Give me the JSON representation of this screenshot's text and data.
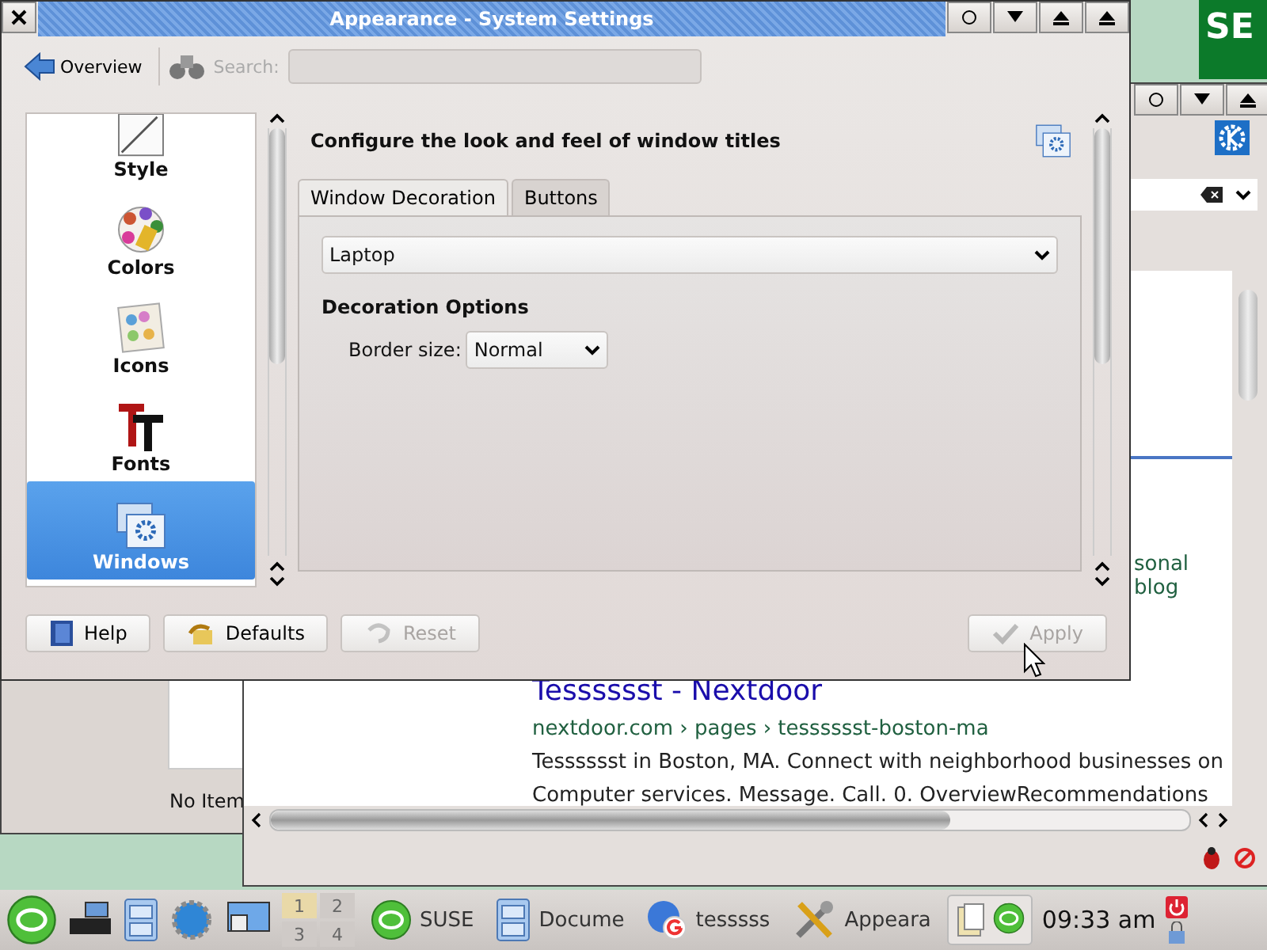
{
  "desktop_logo": {
    "text": "SE"
  },
  "file_window": {
    "status": "No Item"
  },
  "browser": {
    "result_title": "Tesssssst - Nextdoor",
    "result_url": "nextdoor.com › pages › tesssssst-boston-ma",
    "result_snippet": [
      "Tesssssst in Boston, MA. Connect with neighborhood businesses on",
      "Computer services. Message. Call. 0. OverviewRecommendations"
    ],
    "side_text": "sonal blog"
  },
  "window": {
    "title": "Appearance - System Settings"
  },
  "toolbar": {
    "back_label": "Overview",
    "search_label": "Search:"
  },
  "sidebar": {
    "items": [
      {
        "label": "Style",
        "kind": "style",
        "selected": false
      },
      {
        "label": "Colors",
        "kind": "colors",
        "selected": false
      },
      {
        "label": "Icons",
        "kind": "icons",
        "selected": false
      },
      {
        "label": "Fonts",
        "kind": "fonts",
        "selected": false
      },
      {
        "label": "Windows",
        "kind": "windows",
        "selected": true
      }
    ]
  },
  "heading": "Configure the look and feel of window titles",
  "tabs": [
    {
      "label": "Window Decoration",
      "selected": true
    },
    {
      "label": "Buttons",
      "selected": false
    }
  ],
  "decoration": {
    "value": "Laptop"
  },
  "options": {
    "title": "Decoration Options",
    "border_label": "Border size:",
    "border_value": "Normal"
  },
  "buttons": [
    {
      "label": "Help",
      "kind": "help",
      "disabled": false
    },
    {
      "label": "Defaults",
      "kind": "defaults",
      "disabled": false
    },
    {
      "label": "Reset",
      "kind": "reset",
      "disabled": true
    },
    {
      "label": "Apply",
      "kind": "apply",
      "disabled": true
    }
  ],
  "taskbar": {
    "pager": [
      {
        "label": "1",
        "selected": true
      },
      {
        "label": "2",
        "selected": false
      },
      {
        "label": "3",
        "selected": false
      },
      {
        "label": "4",
        "selected": false
      }
    ],
    "tasks": [
      {
        "label": "SUSE",
        "kind": "suse"
      },
      {
        "label": "Docume",
        "kind": "cabinet"
      },
      {
        "label": "tesssss",
        "kind": "browser"
      },
      {
        "label": "Appeara",
        "kind": "tools"
      }
    ],
    "clock": "09:33 am"
  }
}
